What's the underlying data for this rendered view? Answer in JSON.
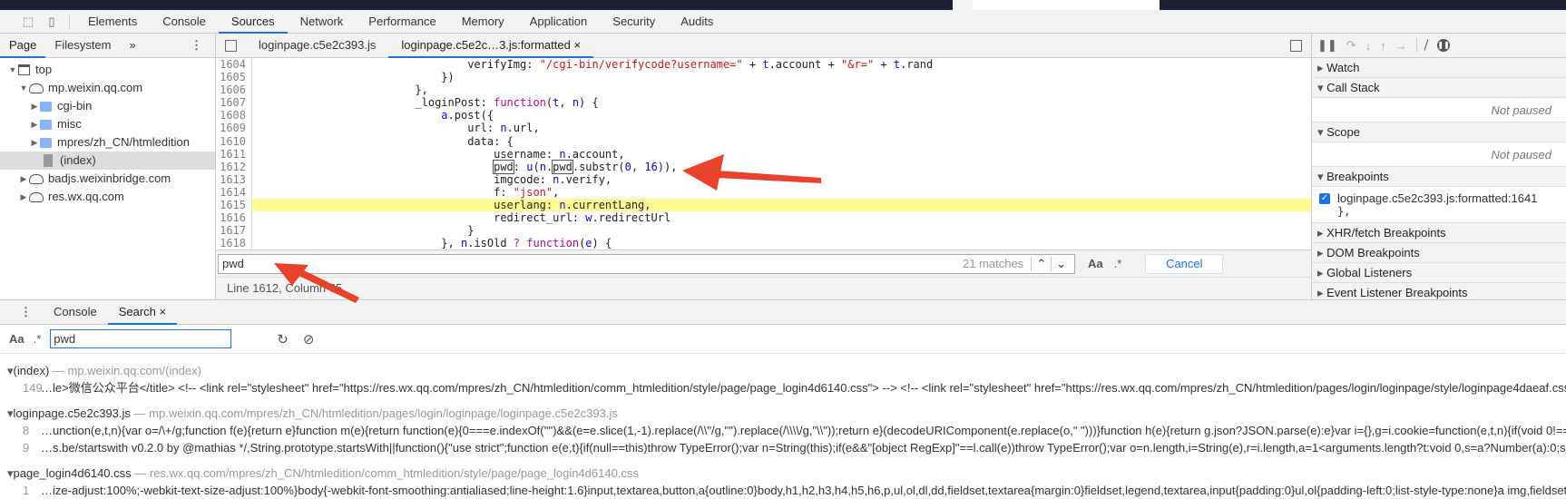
{
  "toolbar": {
    "tabs": [
      "Elements",
      "Console",
      "Sources",
      "Network",
      "Performance",
      "Memory",
      "Application",
      "Security",
      "Audits"
    ],
    "selected": "Sources"
  },
  "navigator": {
    "tabs": [
      "Page",
      "Filesystem"
    ],
    "more": "»",
    "tree": [
      {
        "label": "top",
        "icon": "frame-icon",
        "depth": 0,
        "open": true
      },
      {
        "label": "mp.weixin.qq.com",
        "icon": "cloud-icon",
        "depth": 1,
        "open": true
      },
      {
        "label": "cgi-bin",
        "icon": "folder-icon",
        "depth": 2,
        "open": false
      },
      {
        "label": "misc",
        "icon": "folder-icon",
        "depth": 2,
        "open": false
      },
      {
        "label": "mpres/zh_CN/htmledition",
        "icon": "folder-icon",
        "depth": 2,
        "open": false
      },
      {
        "label": "(index)",
        "icon": "file-icon",
        "depth": 2,
        "selected": true
      },
      {
        "label": "badjs.weixinbridge.com",
        "icon": "cloud-icon",
        "depth": 1,
        "open": false
      },
      {
        "label": "res.wx.qq.com",
        "icon": "cloud-icon",
        "depth": 1,
        "open": false
      }
    ]
  },
  "editor": {
    "tabs": [
      {
        "label": "loginpage.c5e2c393.js"
      },
      {
        "label": "loginpage.c5e2c…3.js:formatted",
        "close": "×",
        "selected": true
      }
    ],
    "highlight_line": 1615,
    "lines": [
      {
        "n": "1604",
        "indent": 32,
        "t": [
          [
            "op",
            "verifyImg: "
          ],
          [
            "str",
            "\"/cgi-bin/verifycode?username=\""
          ],
          [
            "op",
            " + "
          ],
          [
            "var",
            "t"
          ],
          [
            "op",
            ".account + "
          ],
          [
            "str",
            "\"&r=\""
          ],
          [
            "op",
            " + "
          ],
          [
            "var",
            "t"
          ],
          [
            "op",
            ".rand"
          ]
        ]
      },
      {
        "n": "1605",
        "indent": 28,
        "t": [
          [
            "op",
            "})"
          ]
        ]
      },
      {
        "n": "1606",
        "indent": 24,
        "t": [
          [
            "op",
            "},"
          ]
        ]
      },
      {
        "n": "1607",
        "indent": 24,
        "t": [
          [
            "op",
            "_loginPost: "
          ],
          [
            "kw",
            "function"
          ],
          [
            "op",
            "("
          ],
          [
            "var",
            "t"
          ],
          [
            "op",
            ", "
          ],
          [
            "var",
            "n"
          ],
          [
            "op",
            ") {"
          ]
        ]
      },
      {
        "n": "1608",
        "indent": 28,
        "t": [
          [
            "var",
            "a"
          ],
          [
            "op",
            ".post({"
          ]
        ]
      },
      {
        "n": "1609",
        "indent": 32,
        "t": [
          [
            "op",
            "url: "
          ],
          [
            "var",
            "n"
          ],
          [
            "op",
            ".url,"
          ]
        ]
      },
      {
        "n": "1610",
        "indent": 32,
        "t": [
          [
            "op",
            "data: {"
          ]
        ]
      },
      {
        "n": "1611",
        "indent": 36,
        "t": [
          [
            "op",
            "username: "
          ],
          [
            "var",
            "n"
          ],
          [
            "op",
            ".account,"
          ]
        ]
      },
      {
        "n": "1612",
        "indent": 36,
        "t": [
          [
            "box",
            "pwd"
          ],
          [
            "op",
            ": "
          ],
          [
            "var",
            "u"
          ],
          [
            "op",
            "("
          ],
          [
            "var",
            "n"
          ],
          [
            "op",
            "."
          ],
          [
            "box",
            "pwd"
          ],
          [
            "op",
            ".substr("
          ],
          [
            "num",
            "0"
          ],
          [
            "op",
            ", "
          ],
          [
            "num",
            "16"
          ],
          [
            "op",
            ")),"
          ]
        ]
      },
      {
        "n": "1613",
        "indent": 36,
        "t": [
          [
            "op",
            "imgcode: "
          ],
          [
            "var",
            "n"
          ],
          [
            "op",
            ".verify,"
          ]
        ]
      },
      {
        "n": "1614",
        "indent": 36,
        "t": [
          [
            "op",
            "f: "
          ],
          [
            "str",
            "\"json\""
          ],
          [
            "op",
            ","
          ]
        ]
      },
      {
        "n": "1615",
        "indent": 36,
        "t": [
          [
            "op",
            "userlang: "
          ],
          [
            "var",
            "n"
          ],
          [
            "op",
            ".currentLang,"
          ]
        ]
      },
      {
        "n": "1616",
        "indent": 36,
        "t": [
          [
            "op",
            "redirect_url: "
          ],
          [
            "var",
            "w"
          ],
          [
            "op",
            ".redirectUrl"
          ]
        ]
      },
      {
        "n": "1617",
        "indent": 32,
        "t": [
          [
            "op",
            "}"
          ]
        ]
      },
      {
        "n": "1618",
        "indent": 28,
        "t": [
          [
            "op",
            "}, "
          ],
          [
            "var",
            "n"
          ],
          [
            "op",
            ".isOld "
          ],
          [
            "kw",
            "?"
          ],
          [
            "op",
            " "
          ],
          [
            "kw",
            "function"
          ],
          [
            "op",
            "("
          ],
          [
            "var",
            "e"
          ],
          [
            "op",
            ") {"
          ]
        ]
      }
    ],
    "find": {
      "value": "pwd",
      "matches": "21 matches",
      "case_label": "Aa",
      "regex_label": ".*",
      "cancel": "Cancel"
    },
    "status": "Line 1612, Column 65"
  },
  "debugger": {
    "sections": [
      {
        "label": "Watch",
        "open": false
      },
      {
        "label": "Call Stack",
        "open": true,
        "body": "Not paused"
      },
      {
        "label": "Scope",
        "open": true,
        "body": "Not paused"
      },
      {
        "label": "Breakpoints",
        "open": true,
        "breakpoint": {
          "label": "loginpage.c5e2c393.js:formatted:1641",
          "code": "},",
          "checked": true
        }
      },
      {
        "label": "XHR/fetch Breakpoints",
        "open": false
      },
      {
        "label": "DOM Breakpoints",
        "open": false
      },
      {
        "label": "Global Listeners",
        "open": false
      },
      {
        "label": "Event Listener Breakpoints",
        "open": false
      }
    ]
  },
  "drawer": {
    "tabs": [
      {
        "label": "Console"
      },
      {
        "label": "Search",
        "close": "×",
        "selected": true
      }
    ],
    "search": {
      "case_label": "Aa",
      "regex_label": ".*",
      "value": "pwd"
    },
    "results": [
      {
        "file": "(index)",
        "url": "mp.weixin.qq.com/(index)",
        "matches": [
          {
            "line": "149",
            "text": "…le>微信公众平台</title>  <!-- <link rel=\"stylesheet\" href=\"https://res.wx.qq.com/mpres/zh_CN/htmledition/comm_htmledition/style/page/page_login4d6140.css\"> -->  <!-- <link rel=\"stylesheet\" href=\"https://res.wx.qq.com/mpres/zh_CN/htmledition/pages/login/loginpage/style/loginpage4daeaf.css\"> --></head"
          }
        ]
      },
      {
        "file": "loginpage.c5e2c393.js",
        "url": "mp.weixin.qq.com/mpres/zh_CN/htmledition/pages/login/loginpage/loginpage.c5e2c393.js",
        "matches": [
          {
            "line": "8",
            "text": "…unction(e,t,n){var o=/\\+/g;function f(e){return e}function m(e){return function(e){0===e.indexOf('\"')&&(e=e.slice(1,-1).replace(/\\\\\"/g,'\"').replace(/\\\\\\\\/g,\"\\\\\"));return e}(decodeURIComponent(e.replace(o,\" \")))}function h(e){return g.json?JSON.parse(e):e}var i={},g=i.cookie=function(e,t,n){if(void 0!==t){if(n=function(e){for(va"
          },
          {
            "line": "9",
            "text": "…s.be/startswith v0.2.0 by @mathias */,String.prototype.startsWith||function(){\"use strict\";function e(e,t){if(null==this)throw TypeError();var n=String(this);if(e&&\"[object RegExp]\"==l.call(e))throw TypeError();var o=n.length,i=String(e),r=i.length,a=1<arguments.length?t:void 0,s=a?Number(a):0;s!=s&&(s=0);var c=Math.m"
          }
        ]
      },
      {
        "file": "page_login4d6140.css",
        "url": "res.wx.qq.com/mpres/zh_CN/htmledition/comm_htmledition/style/page/page_login4d6140.css",
        "matches": [
          {
            "line": "1",
            "text": "…ize-adjust:100%;-webkit-text-size-adjust:100%}body{-webkit-font-smoothing:antialiased;line-height:1.6}input,textarea,button,a{outline:0}body,h1,h2,h3,h4,h5,h6,p,ul,ol,dl,dd,fieldset,textarea{margin:0}fieldset,legend,textarea,input{padding:0}ul,ol{padding-left:0;list-style-type:none}a img,fieldset{border:0}article,as"
          }
        ]
      }
    ]
  },
  "colors": {
    "accent": "#1a73e8",
    "highlight": "#fffb93",
    "annotation_arrow": "#e8412c"
  }
}
